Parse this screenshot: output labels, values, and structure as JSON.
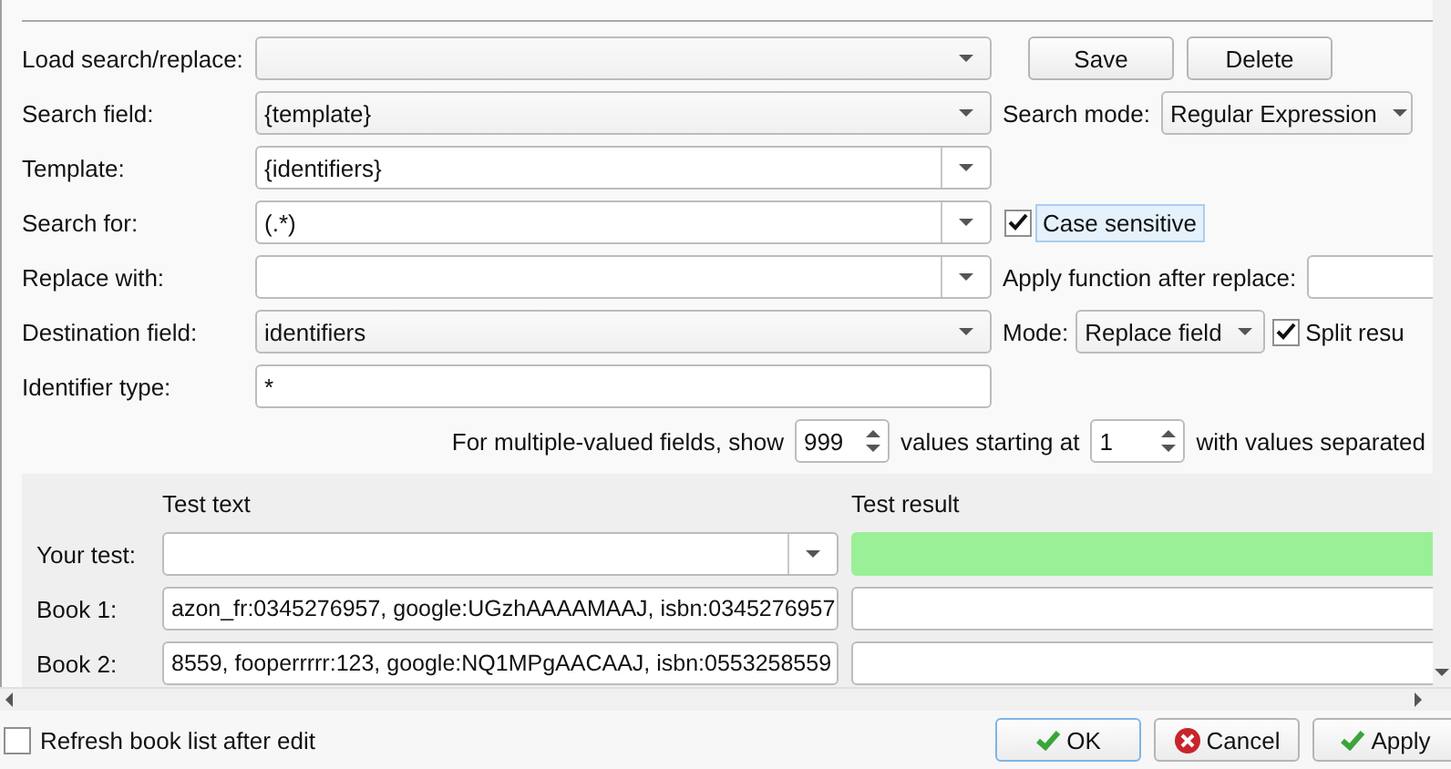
{
  "form_rows": [
    {
      "label": "Load search/replace:",
      "field": {
        "kind": "combo"
      },
      "extra": {
        "kind": "buttons",
        "buttons": [
          "Save",
          "Delete"
        ]
      }
    },
    {
      "label": "Search field:",
      "field": {
        "kind": "combo",
        "value": "{template}"
      },
      "extra": {
        "kind": "select",
        "label": "Search mode:",
        "value": "Regular Expression"
      }
    },
    {
      "label": "Template:",
      "field": {
        "kind": "editable_combo",
        "value": "{identifiers}"
      }
    },
    {
      "label": "Search for:",
      "field": {
        "kind": "editable_combo",
        "value": "(.*)"
      },
      "extra": {
        "kind": "checkbox",
        "label": "Case sensitive",
        "checked": true,
        "focused": true
      }
    },
    {
      "label": "Replace with:",
      "field": {
        "kind": "editable_combo"
      },
      "extra": {
        "kind": "field",
        "label": "Apply function after replace:"
      }
    },
    {
      "label": "Destination field:",
      "field": {
        "kind": "combo",
        "value": "identifiers"
      },
      "extra": {
        "kind": "select_check",
        "label": "Mode:",
        "value": "Replace field",
        "check_label": "Split resu",
        "checked": true
      }
    },
    {
      "label": "Identifier type:",
      "field": {
        "kind": "text",
        "value": "*"
      }
    }
  ],
  "multiple_values": {
    "prefix": "For multiple-valued fields, show",
    "count": "999",
    "middle": "values starting at",
    "start": "1",
    "suffix": "with values separated"
  },
  "test": {
    "text_header": "Test text",
    "result_header": "Test result",
    "rows": [
      {
        "label": "Your test:",
        "kind": "combo",
        "result_match": true
      },
      {
        "label": "Book 1:",
        "kind": "text",
        "value": "azon_fr:0345276957, google:UGzhAAAAMAAJ, isbn:0345276957",
        "result_match": false
      },
      {
        "label": "Book 2:",
        "kind": "text",
        "value": "8559, fooperrrrr:123, google:NQ1MPgAACAAJ, isbn:0553258559",
        "result_match": false
      }
    ]
  },
  "footer": {
    "refresh": {
      "label": "Refresh book list after edit",
      "checked": false
    },
    "buttons": [
      {
        "label": "OK",
        "kind": "ok",
        "default": true
      },
      {
        "label": "Cancel",
        "kind": "cancel",
        "default": false
      },
      {
        "label": "Apply",
        "kind": "apply",
        "default": false
      }
    ]
  }
}
